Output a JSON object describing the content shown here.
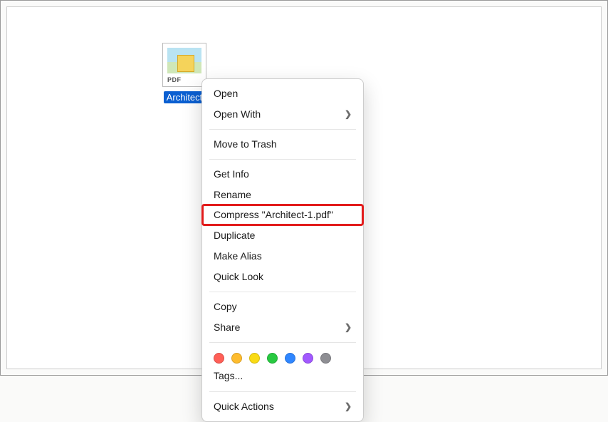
{
  "file": {
    "name": "Architect-1.pdf",
    "label_truncated": "Architect",
    "ext_badge": "PDF"
  },
  "menu": {
    "open": "Open",
    "open_with": "Open With",
    "move_to_trash": "Move to Trash",
    "get_info": "Get Info",
    "rename": "Rename",
    "compress": "Compress \"Architect-1.pdf\"",
    "duplicate": "Duplicate",
    "make_alias": "Make Alias",
    "quick_look": "Quick Look",
    "copy": "Copy",
    "share": "Share",
    "tags": "Tags...",
    "quick_actions": "Quick Actions"
  },
  "tag_colors": [
    "#ff5f57",
    "#febc2e",
    "#fadb14",
    "#28c941",
    "#2f86ff",
    "#a259ff",
    "#8e8e93"
  ]
}
